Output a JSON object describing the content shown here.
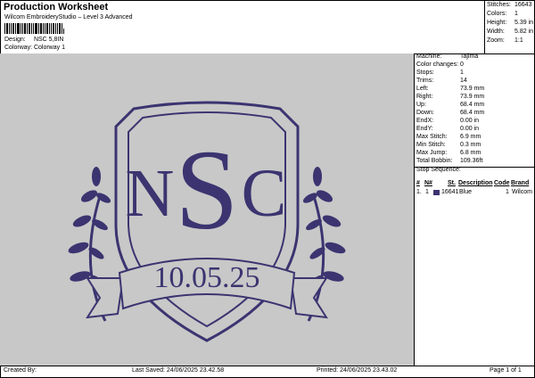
{
  "header": {
    "title": "Production Worksheet",
    "subtitle": "Wilcom EmbroideryStudio – Level 3 Advanced",
    "design_label": "Design:",
    "design_value": "NSC 5,8IN",
    "colorway_label": "Colorway:",
    "colorway_value": "Colorway 1"
  },
  "summary": {
    "stitches_label": "Stitches:",
    "stitches_value": "16643",
    "colors_label": "Colors:",
    "colors_value": "1",
    "height_label": "Height:",
    "height_value": "5.39 in",
    "width_label": "Width:",
    "width_value": "5.82 in",
    "zoom_label": "Zoom:",
    "zoom_value": "1:1"
  },
  "machine_info": [
    {
      "label": "Machine:",
      "value": "Tajima"
    },
    {
      "label": "Color changes:",
      "value": "0"
    },
    {
      "label": "Stops:",
      "value": "1"
    },
    {
      "label": "Trims:",
      "value": "14"
    },
    {
      "label": "Left:",
      "value": "73.9 mm"
    },
    {
      "label": "Right:",
      "value": "73.9 mm"
    },
    {
      "label": "Up:",
      "value": "68.4 mm"
    },
    {
      "label": "Down:",
      "value": "68.4 mm"
    },
    {
      "label": "EndX:",
      "value": "0.00 in"
    },
    {
      "label": "EndY:",
      "value": "0.00 in"
    },
    {
      "label": "Max Stitch:",
      "value": "6.9 mm"
    },
    {
      "label": "Min Stitch:",
      "value": "0.3 mm"
    },
    {
      "label": "Max Jump:",
      "value": "6.8 mm"
    },
    {
      "label": "Total Bobbin:",
      "value": "109.36ft"
    }
  ],
  "stop_sequence": {
    "heading": "Stop Sequence:",
    "columns": [
      "#",
      "N#",
      "St.",
      "Description",
      "Code",
      "Brand"
    ],
    "rows": [
      {
        "num": "1.",
        "needle": "1",
        "stitches": "16641",
        "description": "Blue",
        "code": "1",
        "brand": "Wilcom",
        "color": "#3b3470"
      }
    ]
  },
  "design": {
    "letters": [
      "N",
      "S",
      "C"
    ],
    "date": "10.05.25",
    "thread_color": "#3b3470",
    "background_color": "#c8c8c8"
  },
  "footer": {
    "created_by": "Created By:",
    "last_saved": "Last Saved: 24/06/2025 23.42.58",
    "printed": "Printed: 24/06/2025 23.43.02",
    "page": "Page 1 of 1"
  }
}
